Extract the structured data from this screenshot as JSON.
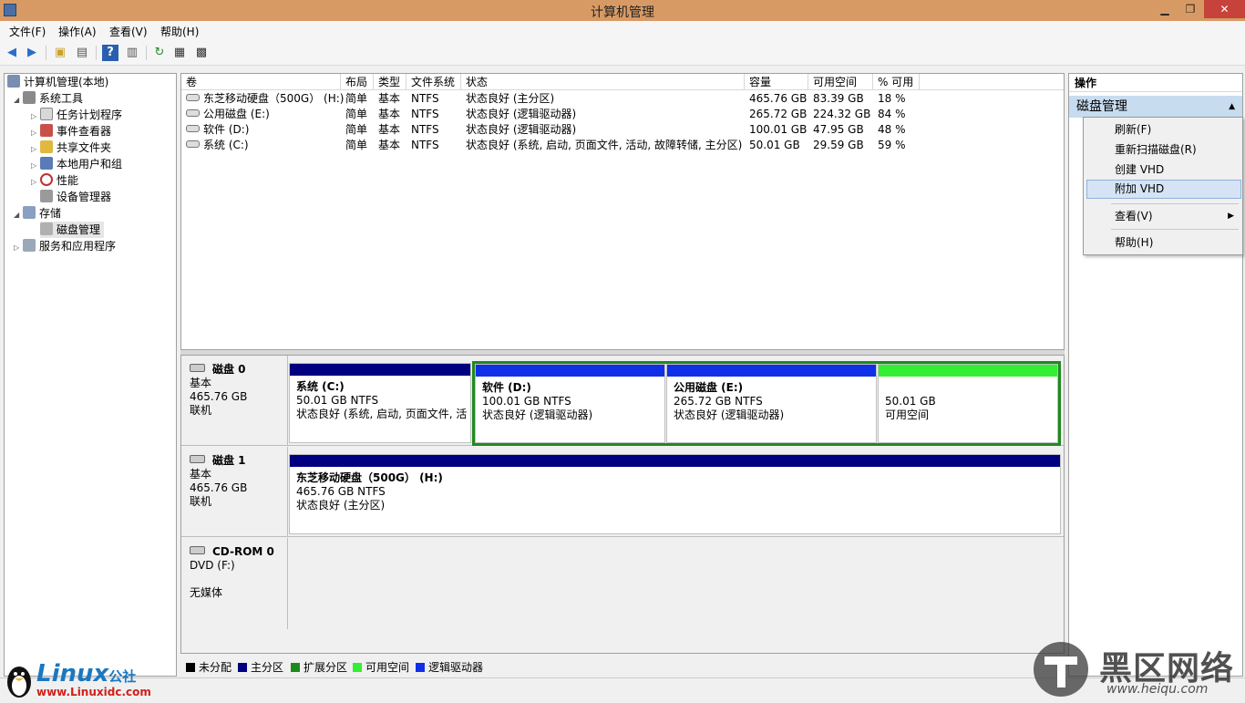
{
  "window": {
    "title": "计算机管理",
    "minimize": "▁",
    "restore": "❐",
    "close": "✕"
  },
  "menu": [
    "文件(F)",
    "操作(A)",
    "查看(V)",
    "帮助(H)"
  ],
  "toolbar": {
    "icons": [
      "back-icon",
      "forward-icon",
      "up-folder-icon",
      "show-hide-tree-icon",
      "help-icon",
      "properties-pane-icon",
      "refresh-icon",
      "properties-icon",
      "rescan-icon"
    ]
  },
  "tree": {
    "root": "计算机管理(本地)",
    "system_tools": "系统工具",
    "task_scheduler": "任务计划程序",
    "event_viewer": "事件查看器",
    "shared_folders": "共享文件夹",
    "local_users": "本地用户和组",
    "performance": "性能",
    "device_manager": "设备管理器",
    "storage": "存储",
    "disk_management": "磁盘管理",
    "services_apps": "服务和应用程序"
  },
  "volumes": {
    "columns": [
      "卷",
      "布局",
      "类型",
      "文件系统",
      "状态",
      "容量",
      "可用空间",
      "% 可用"
    ],
    "rows": [
      [
        "东芝移动硬盘（500G） (H:)",
        "简单",
        "基本",
        "NTFS",
        "状态良好 (主分区)",
        "465.76 GB",
        "83.39 GB",
        "18 %"
      ],
      [
        "公用磁盘 (E:)",
        "简单",
        "基本",
        "NTFS",
        "状态良好 (逻辑驱动器)",
        "265.72 GB",
        "224.32 GB",
        "84 %"
      ],
      [
        "软件 (D:)",
        "简单",
        "基本",
        "NTFS",
        "状态良好 (逻辑驱动器)",
        "100.01 GB",
        "47.95 GB",
        "48 %"
      ],
      [
        "系统 (C:)",
        "简单",
        "基本",
        "NTFS",
        "状态良好 (系统, 启动, 页面文件, 活动, 故障转储, 主分区)",
        "50.01 GB",
        "29.59 GB",
        "59 %"
      ]
    ]
  },
  "disks": {
    "disk0": {
      "name": "磁盘 0",
      "type": "基本",
      "size": "465.76 GB",
      "status": "联机",
      "parts": [
        {
          "name": "系统  (C:)",
          "size": "50.01 GB NTFS",
          "status": "状态良好 (系统, 启动, 页面文件, 活"
        },
        {
          "name": "软件  (D:)",
          "size": "100.01 GB NTFS",
          "status": "状态良好 (逻辑驱动器)"
        },
        {
          "name": "公用磁盘  (E:)",
          "size": "265.72 GB NTFS",
          "status": "状态良好 (逻辑驱动器)"
        },
        {
          "name": "",
          "size": "50.01 GB",
          "status": "可用空间"
        }
      ]
    },
    "disk1": {
      "name": "磁盘 1",
      "type": "基本",
      "size": "465.76 GB",
      "status": "联机",
      "parts": [
        {
          "name": "东芝移动硬盘（500G）  (H:)",
          "size": "465.76 GB NTFS",
          "status": "状态良好 (主分区)"
        }
      ]
    },
    "cdrom": {
      "name": "CD-ROM 0",
      "type": "DVD (F:)",
      "status": "无媒体"
    }
  },
  "legend": [
    "未分配",
    "主分区",
    "扩展分区",
    "可用空间",
    "逻辑驱动器"
  ],
  "colors": {
    "unallocated": "#000000",
    "primary": "#000080",
    "extended": "#1e8a1e",
    "free": "#33ee33",
    "logical": "#1030e8",
    "titlebar": "#d89a64",
    "action_header": "#c8dcf0"
  },
  "actions": {
    "header": "操作",
    "section": "磁盘管理",
    "menu": {
      "refresh": "刷新(F)",
      "rescan": "重新扫描磁盘(R)",
      "create_vhd": "创建 VHD",
      "attach_vhd": "附加 VHD",
      "view": "查看(V)",
      "help": "帮助(H)"
    }
  },
  "watermarks": {
    "left_brand": "Linux",
    "left_suffix": "公社",
    "left_url": "www.Linuxidc.com",
    "right_brand": "黑区网络",
    "right_url": "www.heiqu.com"
  }
}
